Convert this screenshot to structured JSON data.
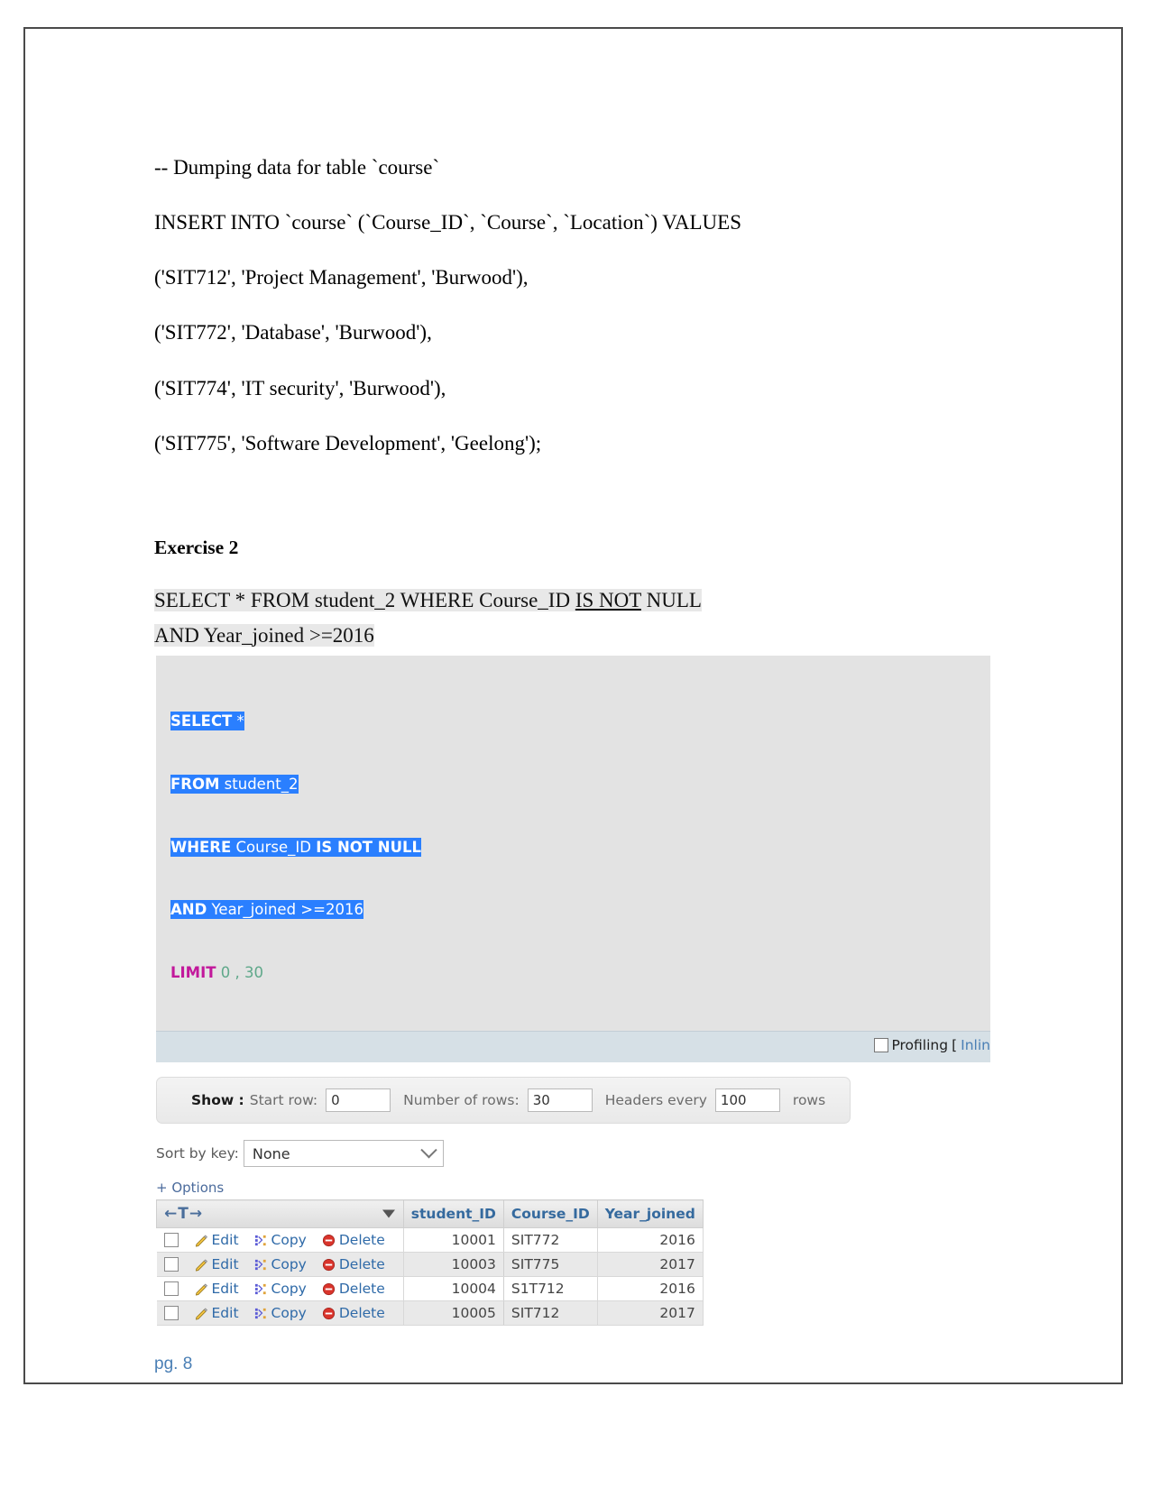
{
  "document": {
    "lines": [
      "-- Dumping data for table `course`",
      "INSERT INTO `course` (`Course_ID`, `Course`, `Location`) VALUES",
      "('SIT712', 'Project Management', 'Burwood'),",
      "('SIT772', 'Database', 'Burwood'),",
      "('SIT774', 'IT security', 'Burwood'),",
      "('SIT775', 'Software Development', 'Geelong');"
    ],
    "exercise_heading": "Exercise 2",
    "query_part1": "SELECT * FROM student_2 WHERE Course_ID ",
    "query_isnot": "IS NOT",
    "query_part2": " NULL",
    "query_line2": "AND Year_joined >=2016",
    "page_number": "pg. 8"
  },
  "phpmyadmin": {
    "sql_editor": {
      "line1_kw": "SELECT",
      "line1_rest": " *",
      "line2_kw": "FROM",
      "line2_rest": " student_2",
      "line3_kw": "WHERE",
      "line3_col": " Course_ID ",
      "line3_kw2": "IS NOT NULL",
      "line4_kw": "AND",
      "line4_rest": " Year_joined >=2016",
      "line5_kw": "LIMIT",
      "line5_rest": " 0 , 30"
    },
    "profiling": {
      "checkbox_label": "Profiling",
      "bracket": "[",
      "inline_link": "Inlin"
    },
    "show_bar": {
      "show_label": "Show :",
      "start_row_label": "Start row:",
      "start_row_value": "0",
      "num_rows_label": "Number of rows:",
      "num_rows_value": "30",
      "headers_label": "Headers every",
      "headers_value": "100",
      "rows_suffix": "rows"
    },
    "sort": {
      "label": "Sort by key:",
      "selected": "None"
    },
    "options_link": "+ Options",
    "results_table": {
      "nav_header": "←T→",
      "columns": [
        "student_ID",
        "Course_ID",
        "Year_joined"
      ],
      "action_labels": {
        "edit": "Edit",
        "copy": "Copy",
        "delete": "Delete"
      },
      "rows": [
        {
          "student_ID": "10001",
          "Course_ID": "SIT772",
          "Year_joined": "2016"
        },
        {
          "student_ID": "10003",
          "Course_ID": "SIT775",
          "Year_joined": "2017"
        },
        {
          "student_ID": "10004",
          "Course_ID": "S1T712",
          "Year_joined": "2016"
        },
        {
          "student_ID": "10005",
          "Course_ID": "SIT712",
          "Year_joined": "2017"
        }
      ]
    }
  },
  "colors": {
    "selection_blue": "#2a7fff",
    "keyword_magenta": "#c2189b",
    "link_blue": "#4a7fb5",
    "header_text": "#356a9e",
    "highlight_gray": "#e8e8e8"
  }
}
